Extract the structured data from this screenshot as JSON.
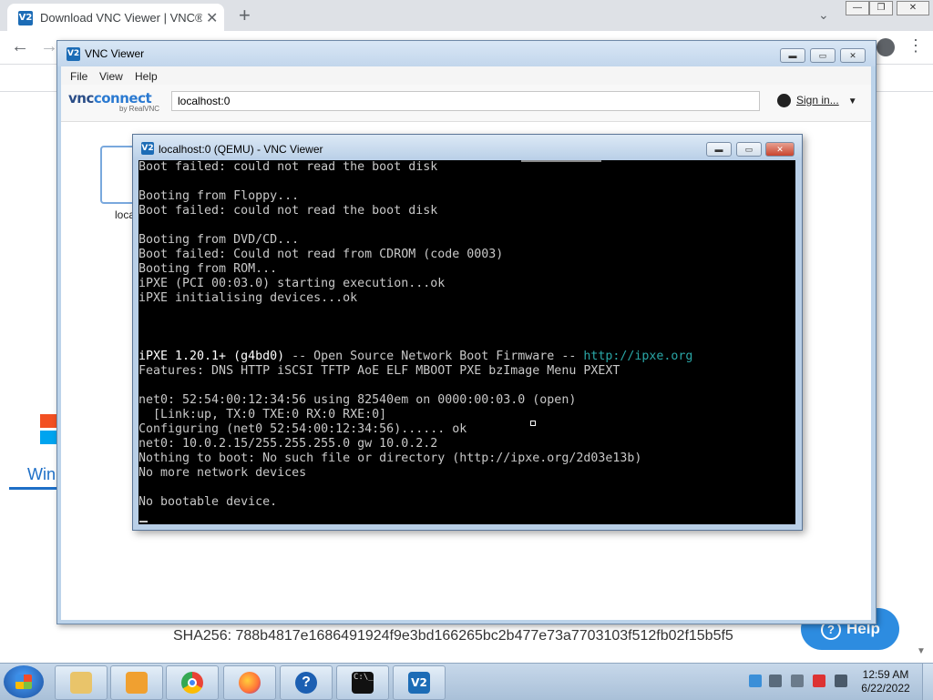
{
  "browser": {
    "tab_title": "Download VNC Viewer | VNC® C",
    "tab_icon": "vnc-icon",
    "tab_close": "✕",
    "new_tab": "+",
    "back": "←",
    "forward": "→",
    "window_controls": {
      "minimize": "—",
      "restore": "❐",
      "close": "✕"
    }
  },
  "webpage": {
    "windows_fragment": "Win",
    "sha": "SHA256: 788b4817e1686491924f9e3bd166265bc2b477e73a7703103f512fb02f15b5f5",
    "help_button": "Help",
    "help_icon": "?"
  },
  "vnc_viewer": {
    "title": "VNC Viewer",
    "logo": "V2",
    "menu": [
      "File",
      "View",
      "Help"
    ],
    "brand_main": "vnc",
    "brand_connect": "connect",
    "brand_sub": "by RealVNC",
    "address_value": "localhost:0",
    "sign_in": "Sign in...",
    "thumbnail_label": "loca",
    "window_controls": {
      "minimize": "▬",
      "maximize": "▭",
      "close": "✕"
    }
  },
  "qemu": {
    "title": "localhost:0 (QEMU) - VNC Viewer",
    "console_lines": [
      {
        "text": "Boot failed: could not read the boot disk"
      },
      {
        "text": ""
      },
      {
        "text": "Booting from Floppy..."
      },
      {
        "text": "Boot failed: could not read the boot disk"
      },
      {
        "text": ""
      },
      {
        "text": "Booting from DVD/CD..."
      },
      {
        "text": "Boot failed: Could not read from CDROM (code 0003)"
      },
      {
        "text": "Booting from ROM..."
      },
      {
        "text": "iPXE (PCI 00:03.0) starting execution...ok"
      },
      {
        "text": "iPXE initialising devices...ok"
      },
      {
        "text": ""
      },
      {
        "text": ""
      },
      {
        "text": ""
      },
      {
        "ipxe_bright": "iPXE 1.20.1+ (g4bd0)",
        "ipxe_rest": " -- Open Source Network Boot Firmware -- ",
        "ipxe_url": "http://ipxe.org"
      },
      {
        "text": "Features: DNS HTTP iSCSI TFTP AoE ELF MBOOT PXE bzImage Menu PXEXT"
      },
      {
        "text": ""
      },
      {
        "text": "net0: 52:54:00:12:34:56 using 82540em on 0000:00:03.0 (open)"
      },
      {
        "text": "  [Link:up, TX:0 TXE:0 RX:0 RXE:0]"
      },
      {
        "text": "Configuring (net0 52:54:00:12:34:56)...... ok"
      },
      {
        "text": "net0: 10.0.2.15/255.255.255.0 gw 10.0.2.2"
      },
      {
        "text": "Nothing to boot: No such file or directory (http://ipxe.org/2d03e13b)"
      },
      {
        "text": "No more network devices"
      },
      {
        "text": ""
      },
      {
        "text": "No bootable device."
      }
    ]
  },
  "taskbar": {
    "items": [
      {
        "name": "windows-explorer"
      },
      {
        "name": "windows-media-player"
      },
      {
        "name": "google-chrome"
      },
      {
        "name": "firefox"
      },
      {
        "name": "help-and-support",
        "glyph": "?"
      },
      {
        "name": "command-prompt",
        "glyph": "C:\\_"
      },
      {
        "name": "vnc-viewer",
        "glyph": "V2"
      }
    ],
    "clock_time": "12:59 AM",
    "clock_date": "6/22/2022"
  }
}
